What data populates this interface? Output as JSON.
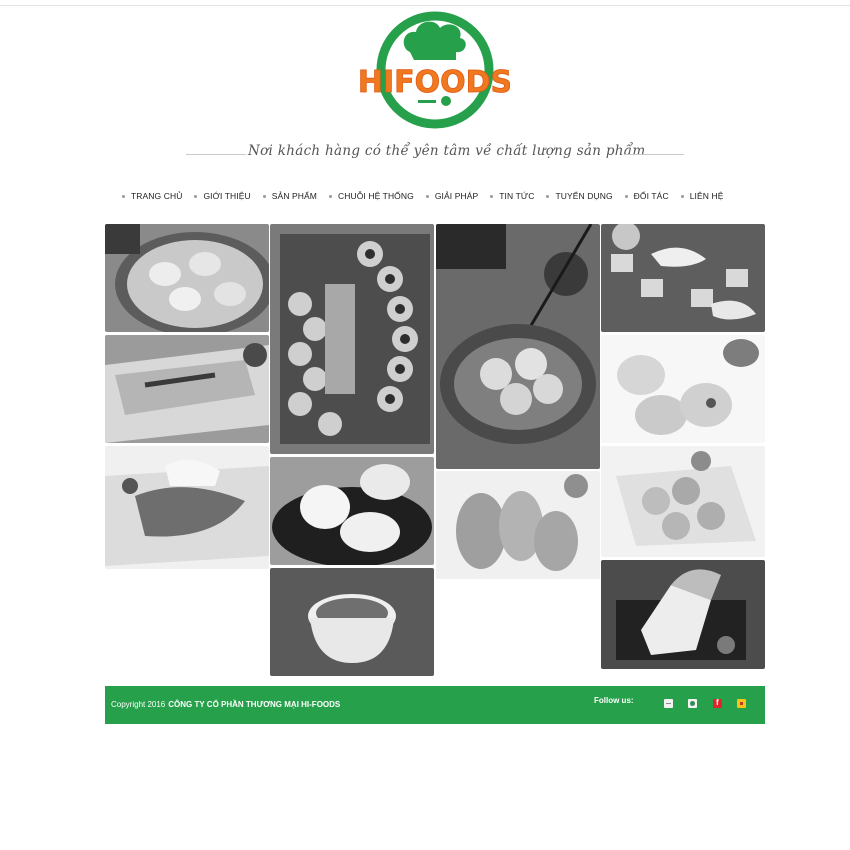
{
  "brand": {
    "logo_text": "HIFOODS",
    "colors": {
      "green": "#26a04a",
      "orange": "#f07820"
    }
  },
  "slogan": "Nơi khách hàng có thể yên tâm về chất lượng sản phẩm",
  "nav": {
    "items": [
      {
        "label": "TRANG CHỦ"
      },
      {
        "label": "GIỚI THIỆU"
      },
      {
        "label": "SẢN PHẨM"
      },
      {
        "label": "CHUỖI HỆ THỐNG"
      },
      {
        "label": "GIẢI PHÁP"
      },
      {
        "label": "TIN TỨC"
      },
      {
        "label": "TUYỂN DỤNG"
      },
      {
        "label": "ĐỐI TÁC"
      },
      {
        "label": "LIÊN HỆ"
      }
    ]
  },
  "gallery": {
    "tiles": [
      {
        "name": "dim-sum-steamer-photo"
      },
      {
        "name": "spring-rolls-photo"
      },
      {
        "name": "grilled-fish-photo"
      },
      {
        "name": "sushi-platter-photo"
      },
      {
        "name": "steamed-buns-photo"
      },
      {
        "name": "soup-bowl-photo"
      },
      {
        "name": "fish-balls-chopsticks-photo"
      },
      {
        "name": "fried-rolls-photo"
      },
      {
        "name": "shrimp-ice-photo"
      },
      {
        "name": "dumplings-photo"
      },
      {
        "name": "seafood-balls-photo"
      },
      {
        "name": "sliced-fruit-photo"
      }
    ]
  },
  "footer": {
    "copyright_prefix": "Copyright 2016",
    "company": "CÔNG TY CỔ PHẦN THƯƠNG MẠI HI-FOODS",
    "follow_label": "Follow us:",
    "social": [
      "social-icon-1",
      "social-icon-2",
      "social-icon-3",
      "social-icon-4"
    ]
  }
}
